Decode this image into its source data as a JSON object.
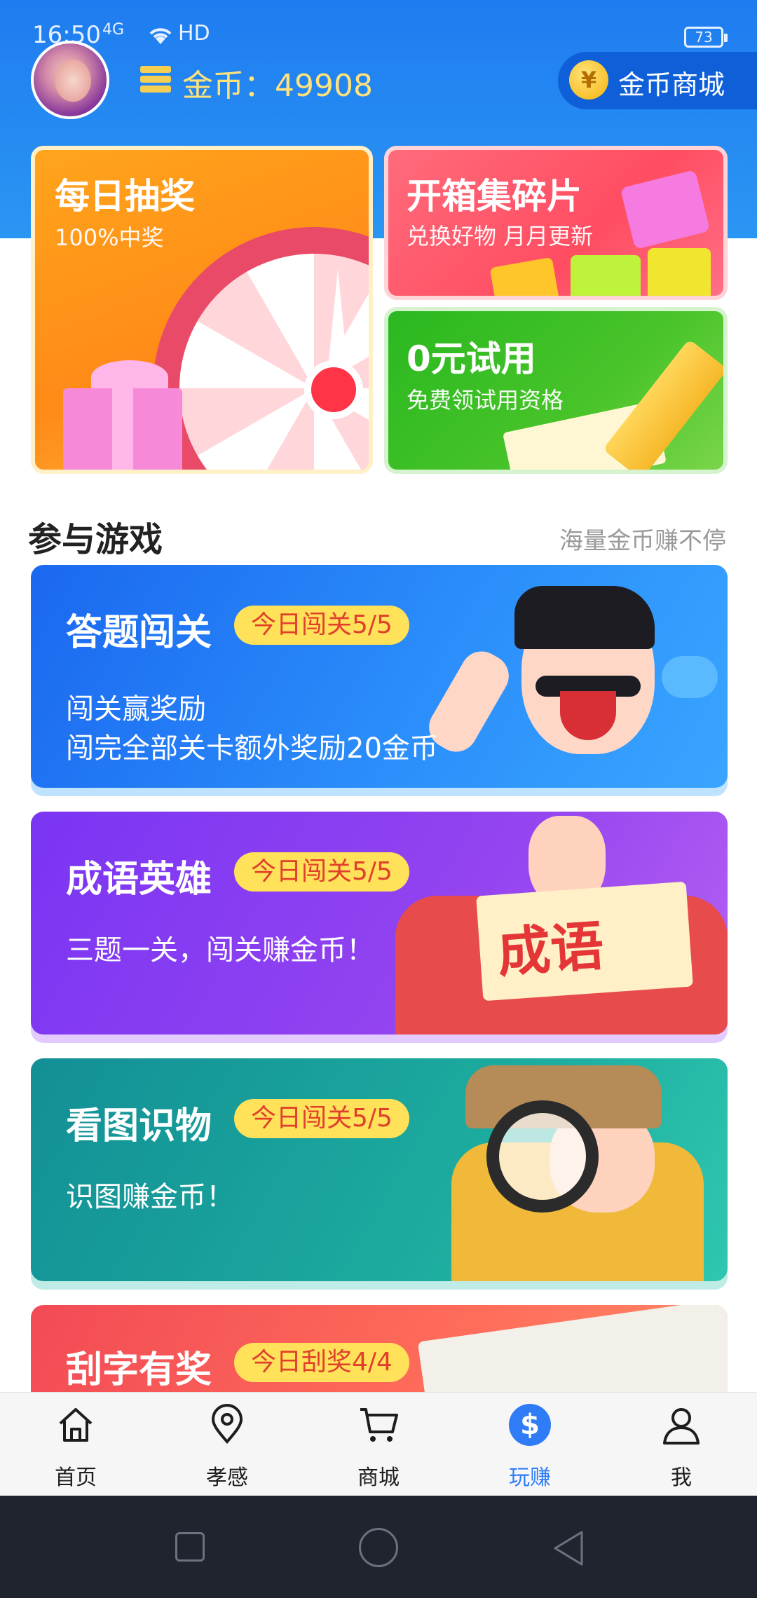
{
  "status_bar": {
    "time": "16:50",
    "signal": "4G",
    "network": "HD",
    "battery": "73"
  },
  "header": {
    "coins_label": "金币：",
    "coins_value": "49908",
    "shop_label": "金币商城",
    "shop_icon": "¥"
  },
  "features": {
    "lottery": {
      "title": "每日抽奖",
      "subtitle": "100%中奖"
    },
    "fragments": {
      "title": "开箱集碎片",
      "subtitle": "兑换好物 月月更新"
    },
    "trial": {
      "title": "0元试用",
      "subtitle": "免费领试用资格"
    }
  },
  "section": {
    "title": "参与游戏",
    "tagline": "海量金币赚不停"
  },
  "games": [
    {
      "title": "答题闯关",
      "badge": "今日闯关5/5",
      "desc_line1": "闯关赢奖励",
      "desc_line2": "闯完全部关卡额外奖励20金币"
    },
    {
      "title": "成语英雄",
      "badge": "今日闯关5/5",
      "desc_line1": "三题一关，闯关赚金币！",
      "sign": "成语"
    },
    {
      "title": "看图识物",
      "badge": "今日闯关5/5",
      "desc_line1": "识图赚金币！"
    },
    {
      "title": "刮字有奖",
      "badge": "今日刮奖4/4"
    }
  ],
  "tabbar": {
    "items": [
      {
        "label": "首页",
        "icon": "home-icon"
      },
      {
        "label": "孝感",
        "icon": "location-pin-icon"
      },
      {
        "label": "商城",
        "icon": "cart-icon"
      },
      {
        "label": "玩赚",
        "icon": "dollar-icon",
        "active": true
      },
      {
        "label": "我",
        "icon": "user-icon"
      }
    ],
    "active_color": "#2f7cf6"
  },
  "colors": {
    "header": "#1f7cf0",
    "badge": "#ffe15a",
    "coin_text": "#ffe27a"
  }
}
